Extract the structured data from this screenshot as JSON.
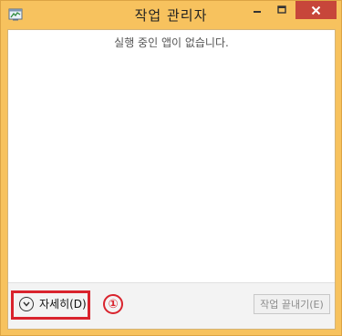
{
  "window": {
    "title": "작업 관리자",
    "colors": {
      "frame": "#f7c25e",
      "close_button": "#c7463a",
      "highlight": "#d9232d"
    }
  },
  "main": {
    "empty_message": "실행 중인 앱이 없습니다."
  },
  "footer": {
    "details_label": "자세히(D)",
    "annotation": "①",
    "end_task_label": "작업 끝내기(E)"
  },
  "icons": {
    "app": "task-manager-icon",
    "minimize": "minimize-icon",
    "maximize": "maximize-icon",
    "close": "close-icon",
    "details": "chevron-down-circle-icon"
  }
}
